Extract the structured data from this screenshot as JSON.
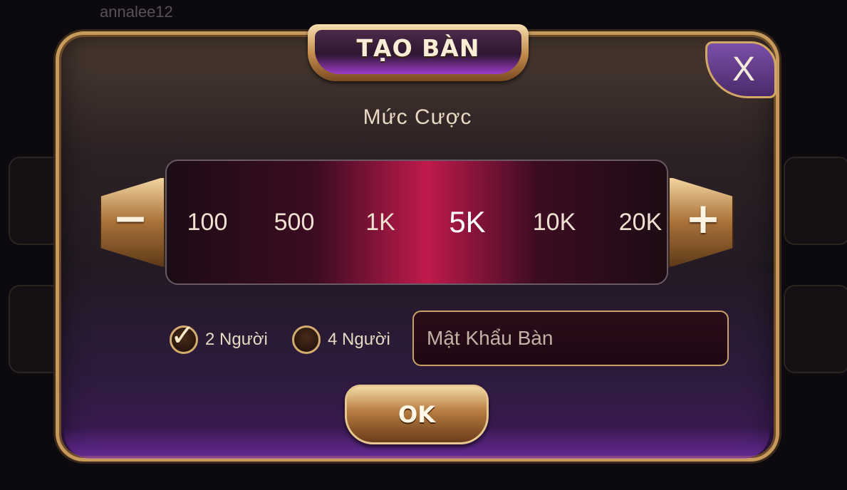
{
  "background": {
    "username": "annalee12"
  },
  "dialog": {
    "title": "TẠO BÀN",
    "close_label": "X",
    "bet_label": "Mức Cược",
    "bet_options": [
      "100",
      "500",
      "1K",
      "5K",
      "10K",
      "20K"
    ],
    "selected_bet": "5K",
    "decrease_label": "−",
    "increase_label": "+",
    "players": [
      {
        "label": "2 Người",
        "checked": true
      },
      {
        "label": "4 Người",
        "checked": false
      }
    ],
    "check_glyph": "✓",
    "password": {
      "value": "",
      "placeholder": "Mật Khẩu Bàn"
    },
    "ok_label": "OK"
  },
  "colors": {
    "gold_border": "#c79a5c",
    "strip_center": "#c01a4c",
    "purple_glow": "#9b3bc9"
  }
}
